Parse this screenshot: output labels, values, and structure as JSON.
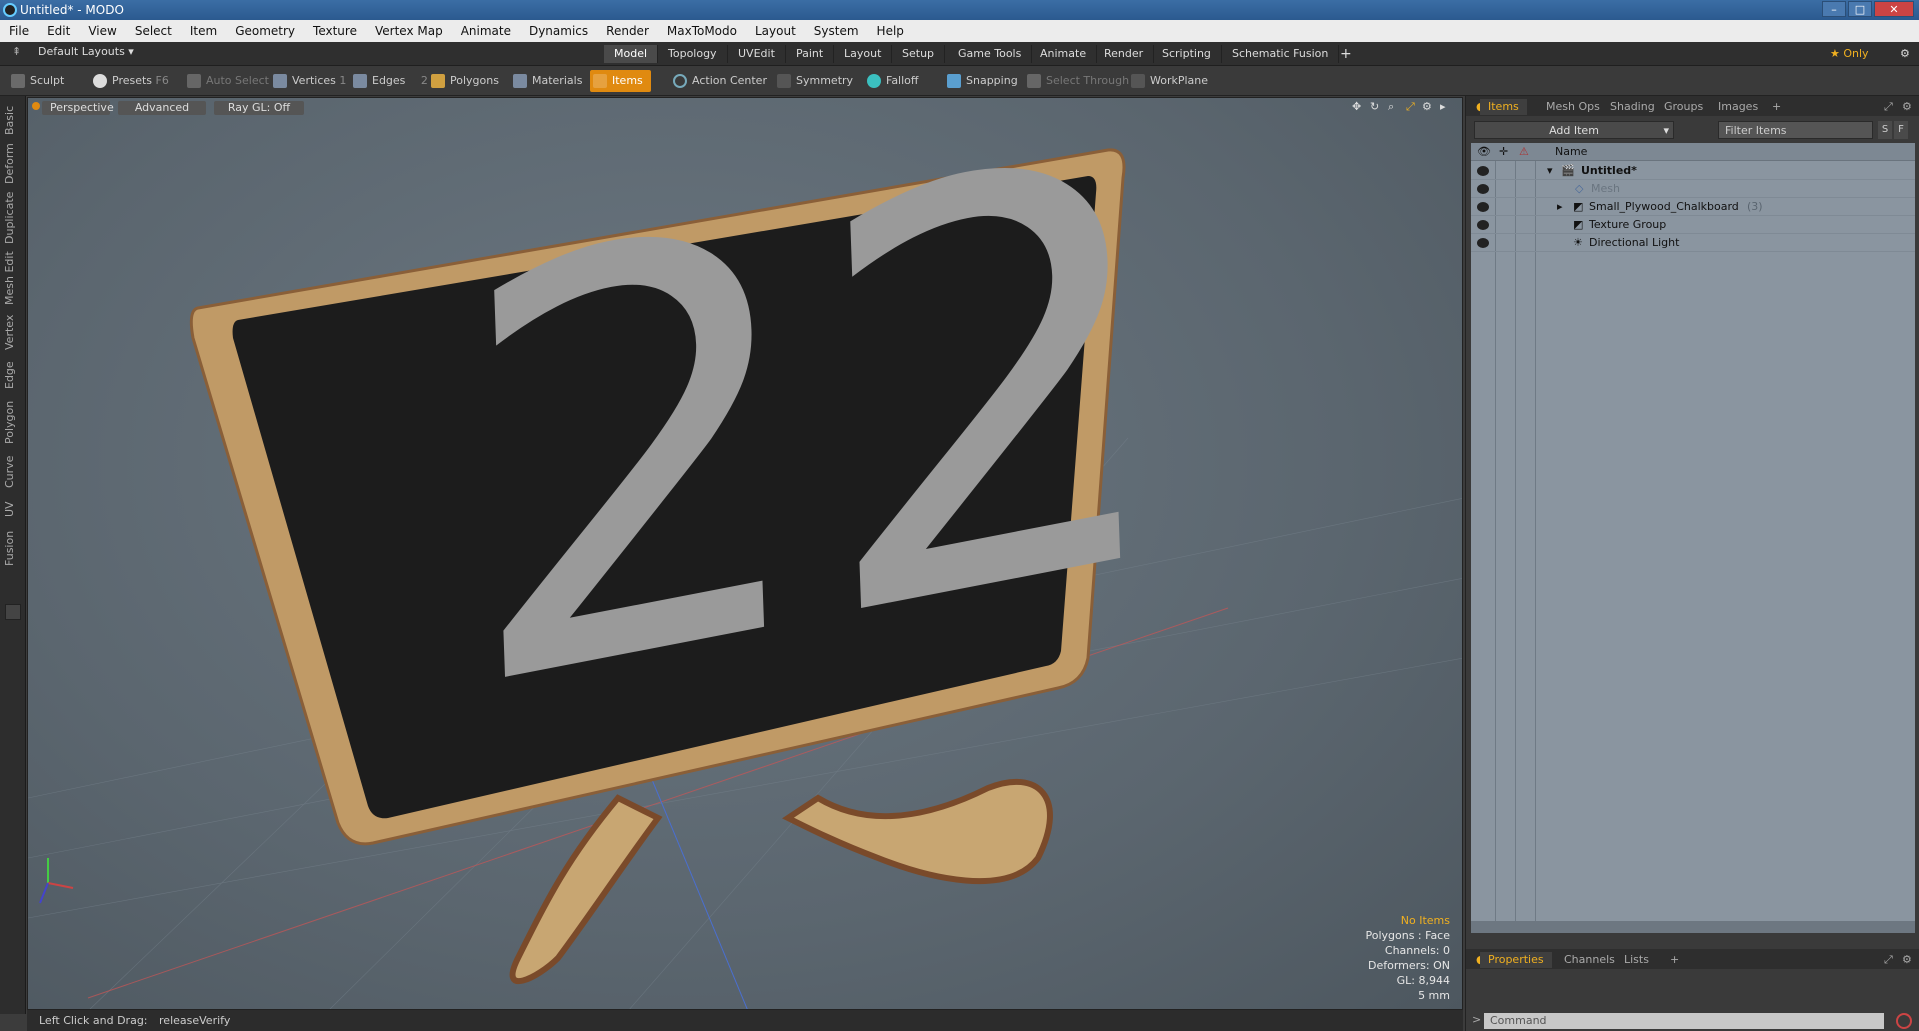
{
  "window": {
    "title": "Untitled* - MODO"
  },
  "menu": [
    "File",
    "Edit",
    "View",
    "Select",
    "Item",
    "Geometry",
    "Texture",
    "Vertex Map",
    "Animate",
    "Dynamics",
    "Render",
    "MaxToModo",
    "Layout",
    "System",
    "Help"
  ],
  "layout_bar": {
    "layout_label": "Default Layouts ▾",
    "tabs": [
      "Model",
      "Topology",
      "UVEdit",
      "Paint",
      "Layout",
      "Setup",
      "Game Tools",
      "Animate",
      "Render",
      "Scripting",
      "Schematic Fusion"
    ],
    "active_tab": "Model",
    "plus": "+",
    "only_label": "★ Only"
  },
  "toolbar": {
    "sculpt": "Sculpt",
    "presets": "Presets",
    "presets_key": "F6",
    "auto_select": "Auto Select",
    "vertices": "Vertices",
    "vertices_num": "1",
    "edges": "Edges",
    "edges_num": "2",
    "polygons": "Polygons",
    "materials": "Materials",
    "items": "Items",
    "action_center": "Action Center",
    "symmetry": "Symmetry",
    "falloff": "Falloff",
    "snapping": "Snapping",
    "select_through": "Select Through",
    "workplane": "WorkPlane"
  },
  "left_tabs": [
    "Basic",
    "Deform",
    "Duplicate",
    "Mesh Edit",
    "Vertex",
    "Edge",
    "Polygon",
    "Curve",
    "UV",
    "Fusion"
  ],
  "viewport": {
    "perspective": "Perspective",
    "advanced": "Advanced",
    "raygl": "Ray GL: Off",
    "chalk_text": "22",
    "info": {
      "no_items": "No Items",
      "polygons": "Polygons : Face",
      "channels": "Channels: 0",
      "deformers": "Deformers: ON",
      "gl": "GL: 8,944",
      "scale": "5 mm"
    }
  },
  "status": {
    "left": "Left Click and Drag:",
    "right": "releaseVerify"
  },
  "items_panel": {
    "tabs": [
      "Items",
      "Mesh Ops",
      "Shading",
      "Groups",
      "Images",
      "+"
    ],
    "add_item": "Add Item",
    "filter": "Filter Items",
    "s_btn": "S",
    "f_btn": "F",
    "name_header": "Name",
    "rows": [
      {
        "label": "Untitled*",
        "extra": ""
      },
      {
        "label": "Mesh",
        "extra": ""
      },
      {
        "label": "Small_Plywood_Chalkboard",
        "extra": "(3)"
      },
      {
        "label": "Texture Group",
        "extra": ""
      },
      {
        "label": "Directional Light",
        "extra": ""
      }
    ]
  },
  "props_panel": {
    "tabs": [
      "Properties",
      "Channels",
      "Lists",
      "+"
    ],
    "command_placeholder": "Command"
  },
  "colors": {
    "accent": "#e08a10",
    "highlight": "#f0b020",
    "chalkboard": "#1c1c1c",
    "frame": "#b0895a"
  }
}
